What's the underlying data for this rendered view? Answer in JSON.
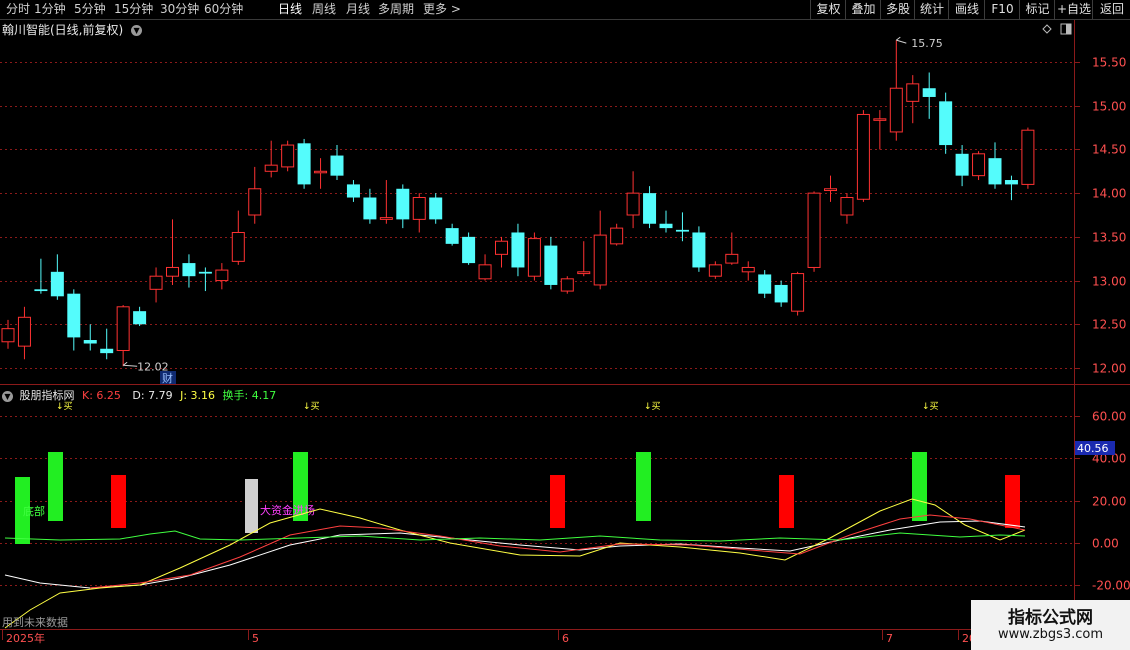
{
  "toolbar": {
    "periods": [
      "分时",
      "1分钟",
      "5分钟",
      "15分钟",
      "30分钟",
      "60分钟",
      "日线",
      "周线",
      "月线",
      "多周期",
      "更多 >"
    ],
    "active_period": "日线",
    "right_buttons": [
      "复权",
      "叠加",
      "多股",
      "统计",
      "画线",
      "F10",
      "标记",
      "+自选",
      "返回"
    ]
  },
  "chart_header": {
    "stock_name": "翰川智能(日线,前复权)"
  },
  "price_axis": {
    "labels": [
      "15.50",
      "15.00",
      "14.50",
      "14.00",
      "13.50",
      "13.00",
      "12.50",
      "12.00"
    ]
  },
  "annotations": {
    "high_label": "15.75",
    "low_label": "12.02",
    "finance_marker": "财"
  },
  "indicator": {
    "name": "股朋指标网",
    "k_label": "K: 6.25",
    "d_label": "D: 7.79",
    "j_label": "J: 3.16",
    "turnover_label": "换手: 4.17",
    "axis_labels": [
      "60.00",
      "40.00",
      "20.00",
      "0.00",
      "-20.00"
    ],
    "current_value": "40.56",
    "text_bottom": "底部",
    "text_big_funds": "大资金进场",
    "top_marker": "↓买"
  },
  "date_axis": {
    "labels": [
      "2025年",
      "5",
      "6",
      "7",
      "20"
    ]
  },
  "footer": {
    "note": "用到未来数据"
  },
  "watermark": {
    "title": "指标公式网",
    "url": "www.zbgs3.com"
  },
  "colors": {
    "up": "#ff3232",
    "down": "#54fcfc",
    "grid": "#8b1a1a",
    "k_line": "#ffffff",
    "d_line": "#ffff44",
    "j_line": "#ff4040",
    "turnover_line": "#40ff40",
    "signal_green": "#22ee22",
    "signal_red": "#ff0000",
    "signal_grey": "#d0d0d0"
  },
  "icons": [
    "circle-chevron-down-icon",
    "diamond-icon",
    "panel-toggle-icon"
  ]
}
